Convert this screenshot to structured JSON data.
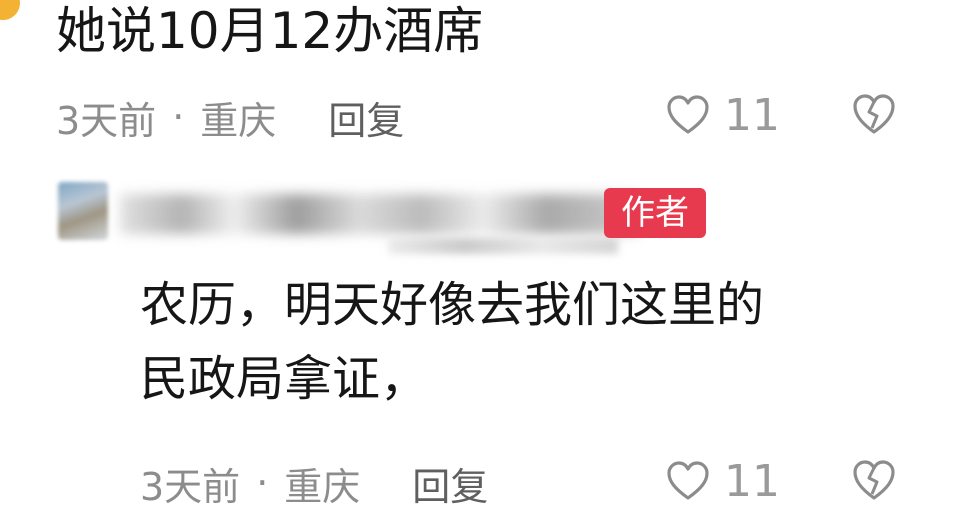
{
  "top_comment": {
    "text": "她说10月12办酒席",
    "time": "3天前",
    "separator": "·",
    "location": "重庆",
    "reply_label": "回复",
    "like_count": "11"
  },
  "reply_comment": {
    "author_badge": "作者",
    "text_lines": [
      "农历，明天好像去我们这里的",
      "民政局拿证，"
    ],
    "time": "3天前",
    "separator": "·",
    "location": "重庆",
    "reply_label": "回复",
    "like_count": "11"
  },
  "colors": {
    "badge": "#e83a4e",
    "meta_text": "#8c8c8c",
    "accent_dot": "#f3b233"
  },
  "icons": {
    "like": "heart-outline-icon",
    "dislike": "broken-heart-icon"
  }
}
